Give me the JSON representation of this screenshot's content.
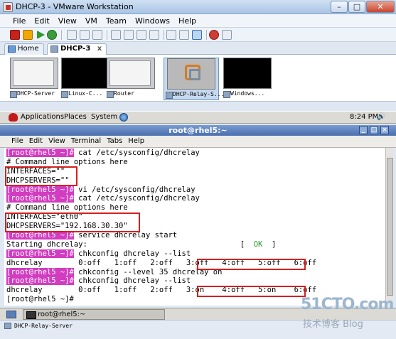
{
  "window": {
    "title": "DHCP-3 - VMware Workstation",
    "minimize": "–",
    "maximize": "□",
    "close": "✕"
  },
  "menubar": [
    "File",
    "Edit",
    "View",
    "VM",
    "Team",
    "Windows",
    "Help"
  ],
  "tabs": [
    {
      "label": "Home",
      "icon": "home-icon"
    },
    {
      "label": "DHCP-3",
      "icon": "vm-icon",
      "close": "x"
    }
  ],
  "thumbnails": [
    "DHCP-Server",
    "Linux-C...",
    "Router",
    "DHCP-Relay-S...",
    "Windows..."
  ],
  "guest_panel": {
    "applications": "Applications",
    "places": "Places",
    "system": "System",
    "clock": "8:24 PM"
  },
  "terminal": {
    "title": "root@rhel5:~",
    "menu": [
      "File",
      "Edit",
      "View",
      "Terminal",
      "Tabs",
      "Help"
    ],
    "lines": [
      {
        "prompt": "[root@rhel5 ~]#",
        "text": " cat /etc/sysconfig/dhcrelay"
      },
      {
        "text": "# Command line options here"
      },
      {
        "text": "INTERFACES=\"\""
      },
      {
        "text": "DHCPSERVERS=\"\""
      },
      {
        "prompt": "[root@rhel5 ~]#",
        "text": " vi /etc/sysconfig/dhcrelay"
      },
      {
        "prompt": "[root@rhel5 ~]#",
        "text": " cat /etc/sysconfig/dhcrelay"
      },
      {
        "text": "# Command line options here"
      },
      {
        "text": "INTERFACES=\"eth0\""
      },
      {
        "text": "DHCPSERVERS=\"192.168.30.30\""
      },
      {
        "prompt": "[root@rhel5 ~]#",
        "text": " service dhcrelay start"
      },
      {
        "text": "Starting dhcrelay:                                  [  ",
        "ok": "OK",
        "tail": "  ]"
      },
      {
        "prompt": "[root@rhel5 ~]#",
        "text": " chkconfig dhcrelay --list"
      },
      {
        "text": "dhcrelay        0:off   1:off   2:off   3:off   4:off   5:off   6:off"
      },
      {
        "prompt": "[root@rhel5 ~]#",
        "text": " chkconfig --level 35 dhcrelay on"
      },
      {
        "prompt": "[root@rhel5 ~]#",
        "text": " chkconfig dhcrelay --list"
      },
      {
        "text": "dhcrelay        0:off   1:off   2:off   3:on    4:off   5:on    6:off"
      },
      {
        "text": "[root@rhel5 ~]# "
      }
    ]
  },
  "taskbar": {
    "task": "root@rhel5:~"
  },
  "statusbar": {
    "text": "DHCP-Relay-Server"
  },
  "watermark": {
    "brand": "51CTO.com",
    "sub": "技术博客 Blog"
  },
  "colors": {
    "prompt_bg": "#d23cc0",
    "highlight_box": "#d42020",
    "ok": "#2e9a2e"
  }
}
